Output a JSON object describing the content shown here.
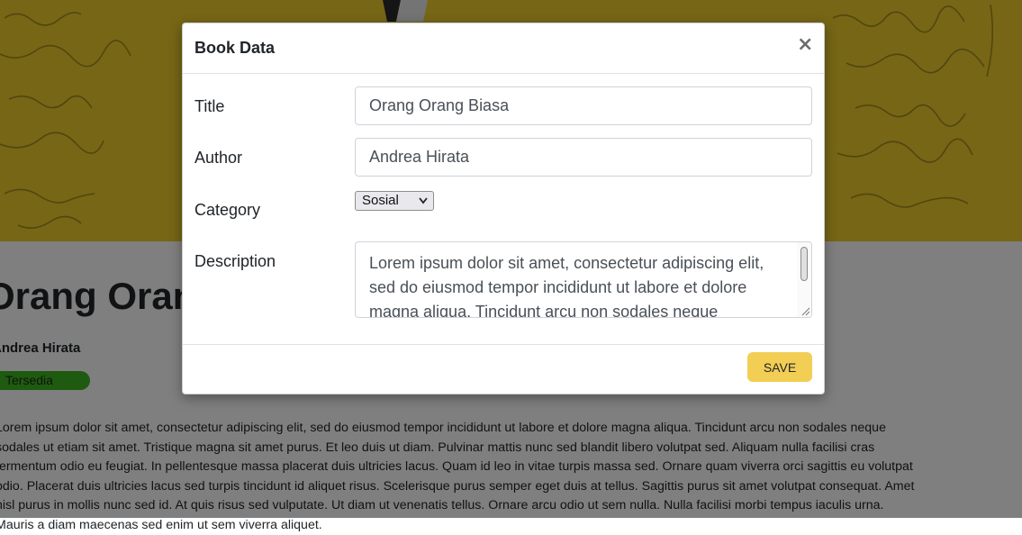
{
  "page": {
    "book_title": "Orang Orang Biasa",
    "author": "Andrea Hirata",
    "status": "Tersedia",
    "description": "Lorem ipsum dolor sit amet, consectetur adipiscing elit, sed do eiusmod tempor incididunt ut labore et dolore magna aliqua. Tincidunt arcu non sodales neque sodales ut etiam sit amet. Tristique magna sit amet purus. Et leo duis ut diam. Pulvinar mattis nunc sed blandit libero volutpat sed. Aliquam nulla facilisi cras fermentum odio eu feugiat. In pellentesque massa placerat duis ultricies lacus. Quam id leo in vitae turpis massa sed. Ornare quam viverra orci sagittis eu volutpat odio. Placerat duis ultricies lacus sed turpis tincidunt id aliquet risus. Scelerisque purus semper eget duis at tellus. Sagittis purus sit amet volutpat consequat. Amet nisl purus in mollis nunc sed id. At quis risus sed vulputate. Ut diam ut venenatis tellus. Ornare arcu odio ut sem nulla. Nulla facilisi morbi tempus iaculis urna. Mauris a diam maecenas sed enim ut sem viverra aliquet."
  },
  "modal": {
    "title": "Book Data",
    "close_label": "×",
    "fields": {
      "title_label": "Title",
      "title_value": "Orang Orang Biasa",
      "author_label": "Author",
      "author_value": "Andrea Hirata",
      "category_label": "Category",
      "category_value": "Sosial",
      "description_label": "Description",
      "description_value": "Lorem ipsum dolor sit amet, consectetur adipiscing elit, sed do eiusmod tempor incididunt ut labore et dolore magna aliqua. Tincidunt arcu non sodales neque sodales ut etiam sit amet."
    },
    "save_label": "SAVE"
  },
  "icons": {
    "close": "close-icon",
    "select_arrow": "chevron-down-icon",
    "resize": "resize-grip-icon"
  },
  "colors": {
    "hero_yellow": "#eccc2c",
    "save_button": "#f2ce55",
    "status_badge": "#3cb521"
  }
}
